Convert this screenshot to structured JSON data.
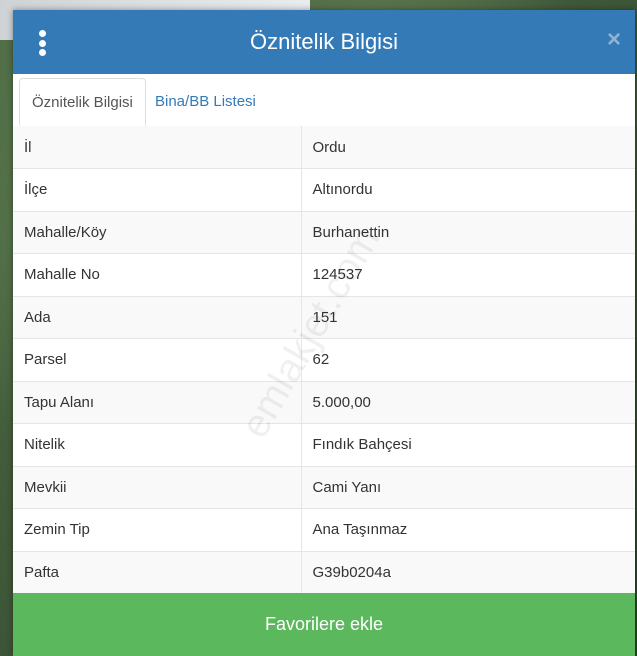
{
  "dialog": {
    "title": "Öznitelik Bilgisi",
    "close_glyph": "×",
    "menu_icon": "kebab-menu-icon"
  },
  "tabs": [
    {
      "label": "Öznitelik Bilgisi",
      "active": true
    },
    {
      "label": "Bina/BB Listesi",
      "active": false
    }
  ],
  "attributes": [
    {
      "key": "İl",
      "value": "Ordu"
    },
    {
      "key": "İlçe",
      "value": "Altınordu"
    },
    {
      "key": "Mahalle/Köy",
      "value": "Burhanettin"
    },
    {
      "key": "Mahalle No",
      "value": "124537"
    },
    {
      "key": "Ada",
      "value": "151"
    },
    {
      "key": "Parsel",
      "value": "62"
    },
    {
      "key": "Tapu Alanı",
      "value": "5.000,00"
    },
    {
      "key": "Nitelik",
      "value": "Fındık Bahçesi"
    },
    {
      "key": "Mevkii",
      "value": "Cami Yanı"
    },
    {
      "key": "Zemin Tip",
      "value": "Ana Taşınmaz"
    },
    {
      "key": "Pafta",
      "value": "G39b0204a"
    }
  ],
  "watermark": "emlakjet.com",
  "footer": {
    "favorite_label": "Favorilere ekle"
  },
  "colors": {
    "header": "#337ab7",
    "button": "#5cb85c",
    "tab_link": "#337ab7"
  }
}
